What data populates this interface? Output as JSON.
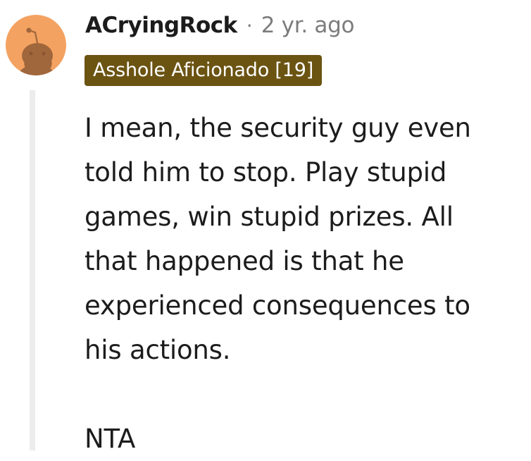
{
  "comment": {
    "username": "ACryingRock",
    "separator": "·",
    "timestamp": "2 yr. ago",
    "flair": "Asshole Aficionado [19]",
    "body_lines": [
      "I mean, the security guy even",
      "told him to stop. Play stupid",
      "games, win stupid prizes. All",
      "that happened is that he",
      "experienced consequences to",
      "his actions."
    ],
    "verdict": "NTA"
  },
  "colors": {
    "avatar_bg": "#f4a261",
    "avatar_figure": "#a0663c",
    "flair_bg": "#6b5312",
    "thread_line": "#ececec",
    "text_primary": "#1c1c1c",
    "text_muted": "#7c7c7c"
  },
  "icons": {
    "avatar": "snoo-avatar-icon"
  }
}
